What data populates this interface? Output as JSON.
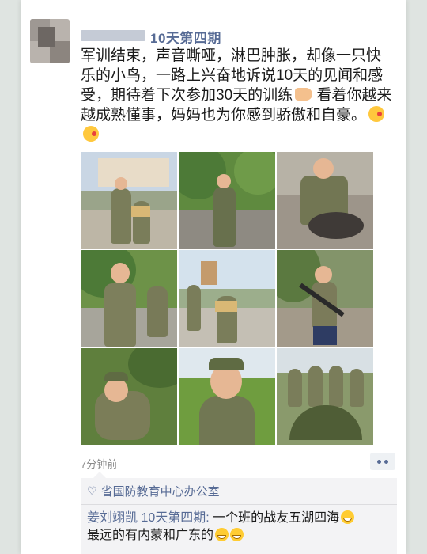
{
  "post": {
    "title": "10天第四期",
    "text_main": "军训结束，声音嘶哑，淋巴肿胀，却像一只快乐的小鸟，一路上兴奋地诉说10天的见闻和感受，期待着下次参加30天的训练",
    "text_tail": " 看着你越来越成熟懂事，妈妈也为你感到骄傲和自豪。",
    "inline_emojis": [
      "flexed-biceps-emoji",
      "face-blowing-kiss-emoji",
      "face-blowing-kiss-emoji"
    ],
    "photos": [
      {
        "name": "photo-certificate-with-instructor"
      },
      {
        "name": "photo-boy-saluting-park"
      },
      {
        "name": "photo-boy-with-basin"
      },
      {
        "name": "photo-boys-in-camouflage"
      },
      {
        "name": "photo-group-certificate"
      },
      {
        "name": "photo-boy-with-rifle"
      },
      {
        "name": "photo-boy-lying-in-grass"
      },
      {
        "name": "photo-boy-portrait-cap"
      },
      {
        "name": "photo-group-with-tent"
      }
    ],
    "timestamp": "7分钟前"
  },
  "comments": {
    "liker": "省国防教育中心办公室",
    "items": [
      {
        "author": "姜刘翊凯  10天第四期:",
        "text": " 一个班的战友五湖四海",
        "text2": "最远的有内蒙和广东的"
      }
    ]
  },
  "colors": {
    "link": "#576b95",
    "text": "#1b1b1b",
    "timestamp": "#8a8a8a",
    "comment_bg": "#f3f3f5"
  }
}
